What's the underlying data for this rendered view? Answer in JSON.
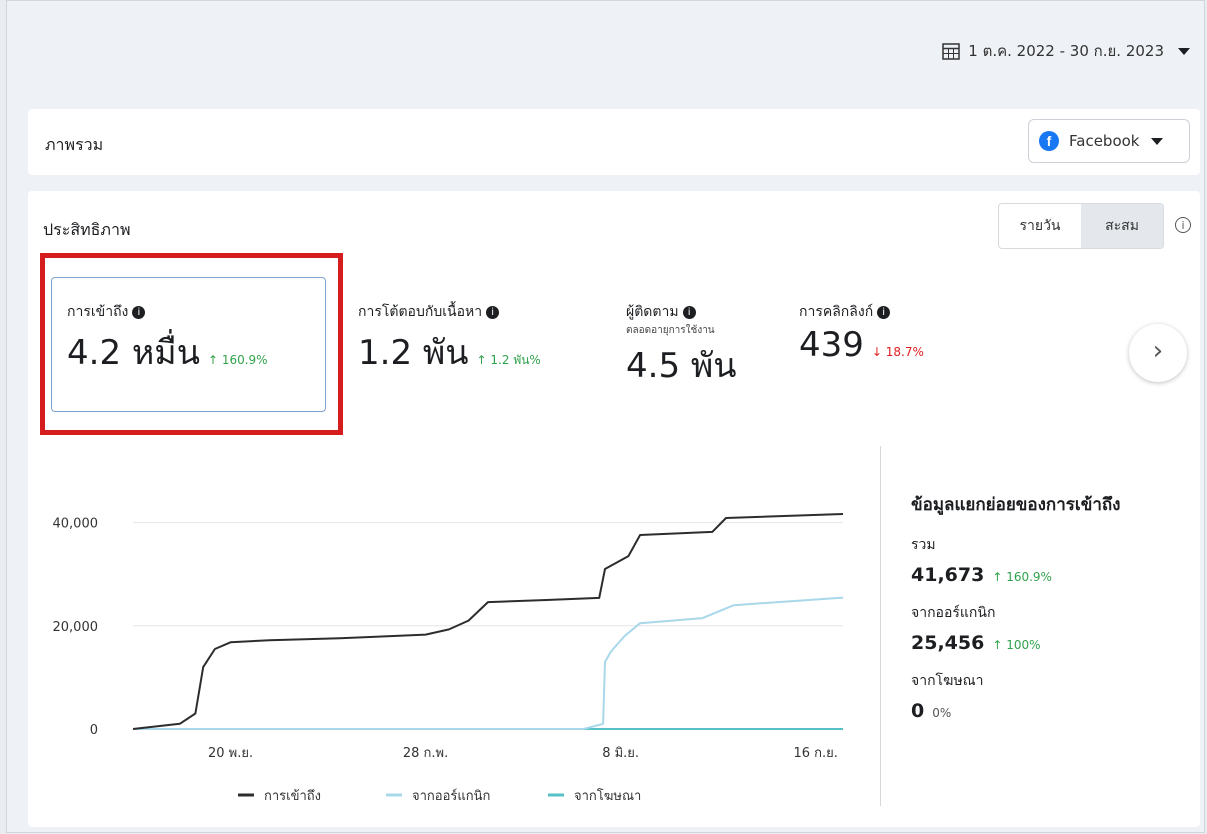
{
  "header": {
    "date_range": "1 ต.ค. 2022 - 30 ก.ย. 2023"
  },
  "overview": {
    "title": "ภาพรวม",
    "platform_select": "Facebook"
  },
  "performance": {
    "title": "ประสิทธิภาพ",
    "toggle": {
      "daily": "รายวัน",
      "cumulative": "สะสม",
      "selected": "cumulative"
    },
    "metrics": [
      {
        "label": "การเข้าถึง",
        "value": "4.2 หมื่น",
        "change": "↑ 160.9%",
        "direction": "up"
      },
      {
        "label": "การโต้ตอบกับเนื้อหา",
        "value": "1.2 พัน",
        "change": "↑ 1.2 พัน%",
        "direction": "up"
      },
      {
        "label": "ผู้ติดตาม",
        "sublabel": "ตลอดอายุการใช้งาน",
        "value": "4.5 พัน"
      },
      {
        "label": "การคลิกลิงก์",
        "value": "439",
        "change": "↓ 18.7%",
        "direction": "down"
      }
    ]
  },
  "breakdown": {
    "title": "ข้อมูลแยกย่อยของการเข้าถึง",
    "items": [
      {
        "label": "รวม",
        "value": "41,673",
        "change": "↑ 160.9%"
      },
      {
        "label": "จากออร์แกนิก",
        "value": "25,456",
        "change": "↑ 100%"
      },
      {
        "label": "จากโฆษณา",
        "value": "0",
        "change": "0%"
      }
    ]
  },
  "colors": {
    "reach": "#2d2d2d",
    "organic": "#a8d8ea",
    "ads": "#56c2c6",
    "up": "#31a24c",
    "down": "#e02020"
  },
  "chart_data": {
    "type": "line",
    "x_ticks": [
      "20 พ.ย.",
      "28 ก.พ.",
      "8 มิ.ย.",
      "16 ก.ย."
    ],
    "y_ticks": [
      "0",
      "20,000",
      "40,000"
    ],
    "ylim": [
      0,
      45000
    ],
    "legend_position": "bottom",
    "series": [
      {
        "name": "การเข้าถึง",
        "color": "#2d2d2d",
        "x": [
          "2022-10-01",
          "2022-10-25",
          "2022-11-02",
          "2022-11-06",
          "2022-11-12",
          "2022-11-20",
          "2022-12-10",
          "2023-01-15",
          "2023-02-10",
          "2023-02-28",
          "2023-03-12",
          "2023-03-22",
          "2023-04-01",
          "2023-05-01",
          "2023-05-28",
          "2023-05-31",
          "2023-06-12",
          "2023-06-18",
          "2023-07-25",
          "2023-08-01",
          "2023-09-30"
        ],
        "values": [
          0,
          1000,
          3000,
          12000,
          15500,
          16800,
          17200,
          17600,
          18000,
          18300,
          19300,
          21000,
          24600,
          25000,
          25400,
          31000,
          33500,
          37600,
          38200,
          40900,
          41673
        ]
      },
      {
        "name": "จากออร์แกนิก",
        "color": "#a8d8ea",
        "x": [
          "2022-10-01",
          "2023-05-20",
          "2023-05-30",
          "2023-05-31",
          "2023-06-03",
          "2023-06-10",
          "2023-06-18",
          "2023-07-20",
          "2023-08-05",
          "2023-09-30"
        ],
        "values": [
          0,
          0,
          1000,
          13000,
          15000,
          18000,
          20500,
          21500,
          24000,
          25456
        ]
      },
      {
        "name": "จากโฆษณา",
        "color": "#56c2c6",
        "x": [
          "2022-10-01",
          "2023-09-30"
        ],
        "values": [
          0,
          0
        ]
      }
    ]
  }
}
